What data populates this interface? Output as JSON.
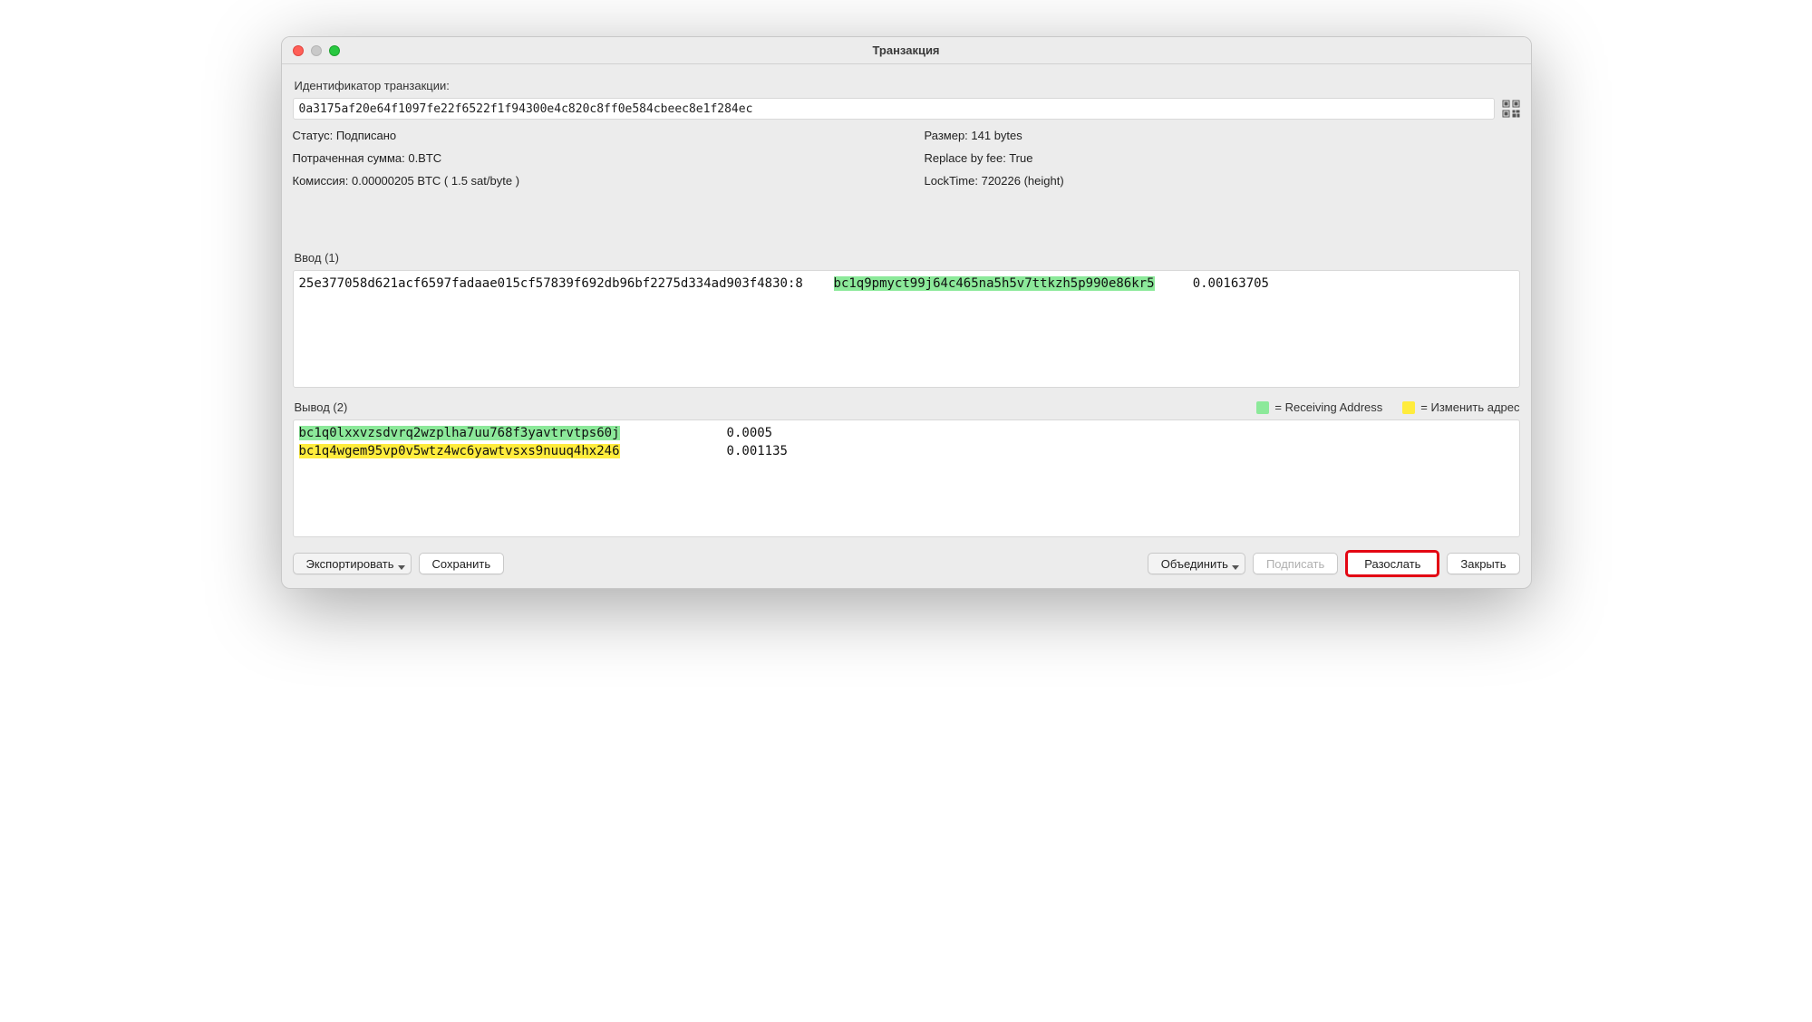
{
  "window": {
    "title": "Транзакция"
  },
  "txid": {
    "label": "Идентификатор транзакции:",
    "value": "0a3175af20e64f1097fe22f6522f1f94300e4c820c8ff0e584cbeec8e1f284ec"
  },
  "info_left": {
    "status": "Статус: Подписано",
    "spent": "Потраченная сумма: 0.BTC",
    "fee": "Комиссия: 0.00000205 BTC  ( 1.5 sat/byte )"
  },
  "info_right": {
    "size": "Размер: 141 bytes",
    "rbf": "Replace by fee: True",
    "locktime": "LockTime: 720226 (height)"
  },
  "inputs": {
    "label": "Ввод (1)",
    "rows": [
      {
        "outpoint": "25e377058d621acf6597fadaae015cf57839f692db96bf2275d334ad903f4830:8",
        "address": "bc1q9pmyct99j64c465na5h5v7ttkzh5p990e86kr5",
        "address_class": "hl-green",
        "amount": "0.00163705"
      }
    ]
  },
  "outputs": {
    "label": "Вывод (2)",
    "legend_receiving": "= Receiving Address",
    "legend_change": "= Изменить адрес",
    "rows": [
      {
        "address": "bc1q0lxxvzsdvrq2wzplha7uu768f3yavtrvtps60j",
        "address_class": "hl-green",
        "amount": "0.0005"
      },
      {
        "address": "bc1q4wgem95vp0v5wtz4wc6yawtvsxs9nuuq4hx246",
        "address_class": "hl-yellow",
        "amount": "0.001135"
      }
    ]
  },
  "buttons": {
    "export": "Экспортировать",
    "save": "Сохранить",
    "combine": "Объединить",
    "sign": "Подписать",
    "broadcast": "Разослать",
    "close": "Закрыть"
  }
}
